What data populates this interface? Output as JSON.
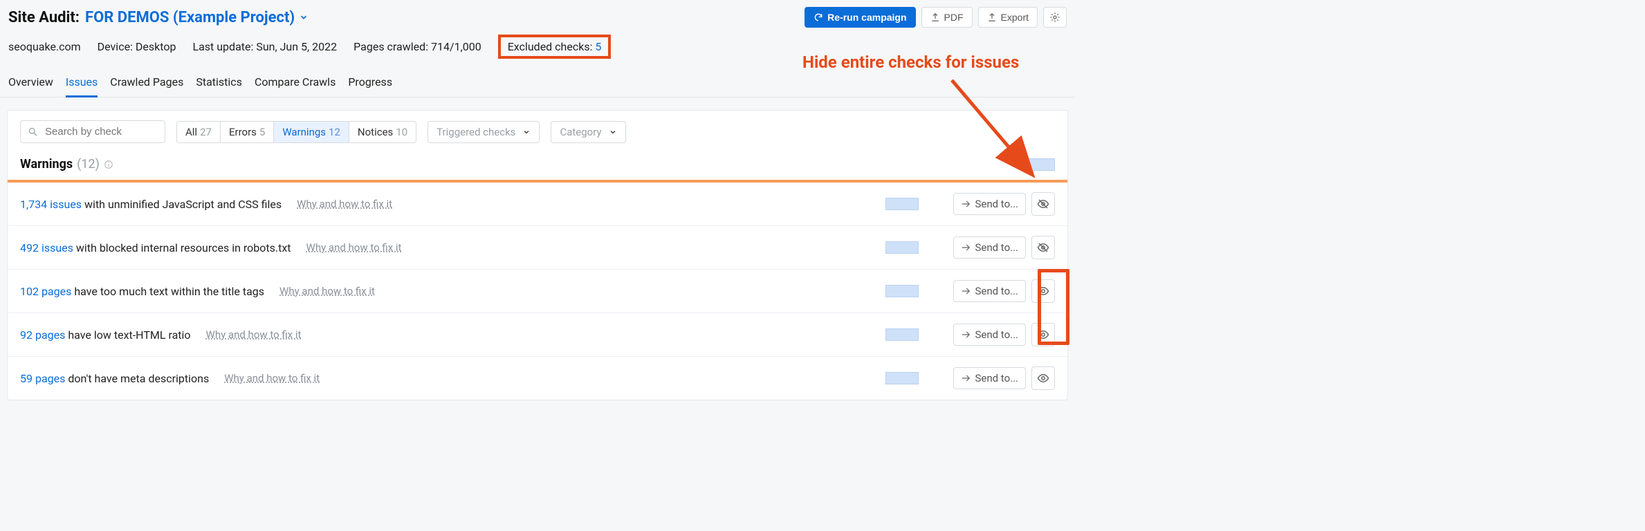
{
  "header": {
    "title_prefix": "Site Audit:",
    "project_name": "FOR DEMOS (Example Project)",
    "rerun_label": "Re-run campaign",
    "pdf_label": "PDF",
    "export_label": "Export"
  },
  "meta": {
    "domain": "seoquake.com",
    "device_label": "Device:",
    "device_value": "Desktop",
    "last_update_label": "Last update:",
    "last_update_value": "Sun, Jun 5, 2022",
    "crawled_label": "Pages crawled:",
    "crawled_value": "714/1,000",
    "excluded_label": "Excluded checks:",
    "excluded_value": "5"
  },
  "tabs": [
    "Overview",
    "Issues",
    "Crawled Pages",
    "Statistics",
    "Compare Crawls",
    "Progress"
  ],
  "filters": {
    "search_placeholder": "Search by check",
    "seg": [
      {
        "label": "All",
        "count": "27"
      },
      {
        "label": "Errors",
        "count": "5"
      },
      {
        "label": "Warnings",
        "count": "12"
      },
      {
        "label": "Notices",
        "count": "10"
      }
    ],
    "triggered_label": "Triggered checks",
    "category_label": "Category"
  },
  "section": {
    "title": "Warnings",
    "count": "(12)"
  },
  "rows": [
    {
      "link": "1,734 issues",
      "rest": " with unminified JavaScript and CSS files",
      "hidden": true
    },
    {
      "link": "492 issues",
      "rest": " with blocked internal resources in robots.txt",
      "hidden": true
    },
    {
      "link": "102 pages",
      "rest": " have too much text within the title tags",
      "hidden": false
    },
    {
      "link": "92 pages",
      "rest": " have low text-HTML ratio",
      "hidden": false
    },
    {
      "link": "59 pages",
      "rest": " don't have meta descriptions",
      "hidden": false
    }
  ],
  "strings": {
    "fix": "Why and how to fix it",
    "send": "Send to..."
  },
  "annotation": "Hide entire checks for issues"
}
